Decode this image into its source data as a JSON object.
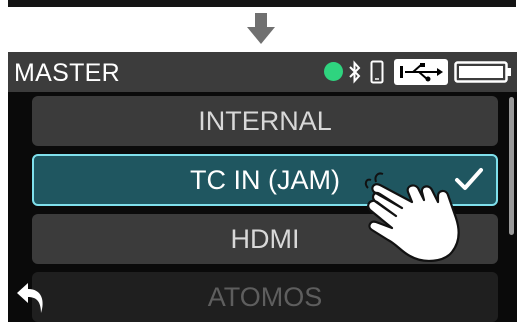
{
  "header": {
    "title": "MASTER",
    "status_icons": [
      "green-status-dot",
      "bluetooth-icon",
      "phone-icon",
      "usb-icon",
      "battery-icon"
    ]
  },
  "colors": {
    "status_dot": "#2fd47f",
    "selected_fill": "#1f5660",
    "selected_border": "#7fe0ec"
  },
  "menu": {
    "items": [
      {
        "label": "INTERNAL",
        "state": "normal"
      },
      {
        "label": "TC IN (JAM)",
        "state": "selected"
      },
      {
        "label": "HDMI",
        "state": "normal"
      },
      {
        "label": "ATOMOS",
        "state": "dimmed"
      }
    ],
    "selected_index": 1
  },
  "footer": {
    "back_icon": "back-arrow-icon"
  },
  "annotation": {
    "arrow_icon": "down-arrow-icon",
    "pointer_icon": "tapping-hand-icon"
  }
}
